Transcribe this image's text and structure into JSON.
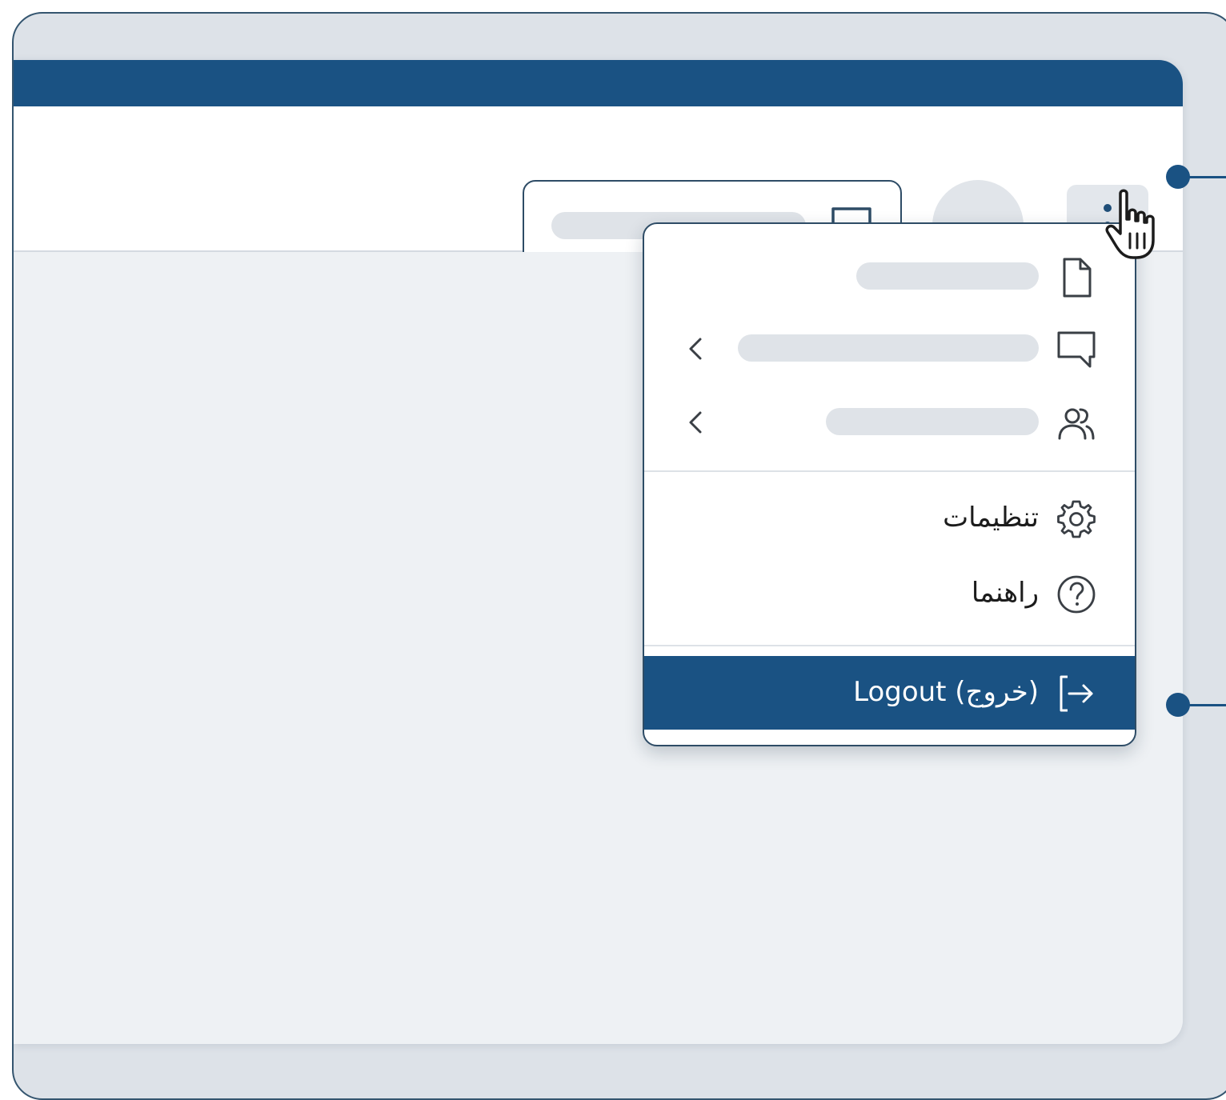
{
  "header": {
    "search": {
      "icon": "chat-bubble-icon"
    },
    "avatar": {},
    "more_button": {
      "icon": "kebab-vertical-icon"
    }
  },
  "menu": {
    "items": [
      {
        "icon": "document-icon",
        "has_submenu": false
      },
      {
        "icon": "chat-bubble-icon",
        "has_submenu": true
      },
      {
        "icon": "users-icon",
        "has_submenu": true
      },
      {
        "icon": "gear-icon",
        "label": "تنظیمات"
      },
      {
        "icon": "help-circle-icon",
        "label": "راهنما"
      },
      {
        "icon": "logout-icon",
        "label": "Logout (خروج)"
      }
    ],
    "highlighted_item": "Logout (خروج)"
  },
  "colors": {
    "accent": "#1a5283",
    "outline": "#2e4c66",
    "placeholder": "#dfe3e8",
    "frame_bg": "#dde2e8",
    "content_bg": "#eef1f4"
  }
}
